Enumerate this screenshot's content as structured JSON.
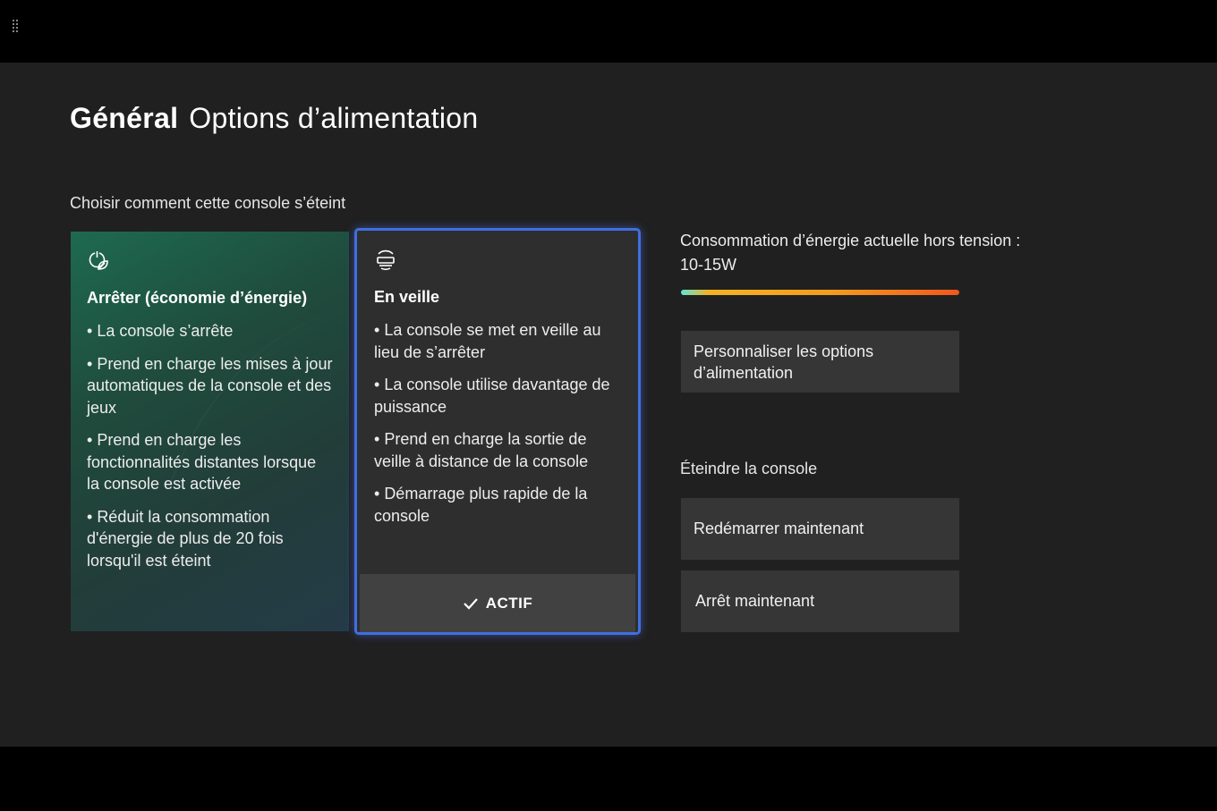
{
  "header": {
    "title_strong": "Général",
    "title_light": "Options d’alimentation"
  },
  "section": {
    "label": "Choisir comment cette console s’éteint"
  },
  "cards": [
    {
      "icon": "power-leaf-icon",
      "title": "Arrêter (économie d’énergie)",
      "bullets": [
        "La console s’arrête",
        "Prend en charge les mises à jour automatiques de la console et des jeux",
        "Prend en charge les fonctionnalités distantes lorsque la console est activée",
        "Réduit la consommation d'énergie de plus de 20 fois lorsqu'il est éteint"
      ]
    },
    {
      "icon": "standby-console-icon",
      "title": "En veille",
      "bullets": [
        "La console se met en veille au lieu de s’arrêter",
        "La console utilise davantage de puissance",
        "Prend en charge la sortie de veille à distance de la console",
        "Démarrage plus rapide de la console"
      ],
      "status": "ACTIF"
    }
  ],
  "power": {
    "label_line1": "Consommation d’énergie actuelle hors tension :",
    "label_line2": "10-15W",
    "customize_button": "Personnaliser les options d’alimentation"
  },
  "shutdown": {
    "label": "Éteindre la console",
    "restart_button": "Redémarrer maintenant",
    "shutdown_button": "Arrêt maintenant"
  },
  "colors": {
    "focus_border": "#3f6fe0",
    "background": "#202020"
  }
}
